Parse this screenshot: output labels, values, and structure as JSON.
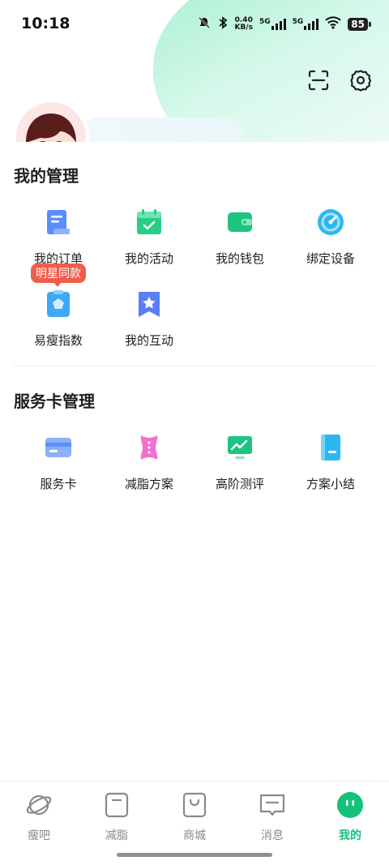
{
  "status_bar": {
    "time": "10:18",
    "net_speed_value": "0.40",
    "net_speed_unit": "KB/s",
    "signal1_label": "5G",
    "signal2_label": "5G",
    "battery": "85"
  },
  "colors": {
    "accent": "#12C27A",
    "badge": "#F25C4A"
  },
  "header": {
    "scan_icon": "scan-icon",
    "settings_icon": "gear-icon"
  },
  "management": {
    "title": "我的管理",
    "items": [
      {
        "label": "我的订单",
        "icon": "order-icon"
      },
      {
        "label": "我的活动",
        "icon": "calendar-check-icon"
      },
      {
        "label": "我的钱包",
        "icon": "wallet-icon"
      },
      {
        "label": "绑定设备",
        "icon": "device-bind-icon"
      },
      {
        "label": "易瘦指数",
        "icon": "clipboard-pentagon-icon",
        "badge": "明星同款"
      },
      {
        "label": "我的互动",
        "icon": "star-bookmark-icon"
      }
    ]
  },
  "service_cards": {
    "title": "服务卡管理",
    "items": [
      {
        "label": "服务卡",
        "icon": "card-icon"
      },
      {
        "label": "减脂方案",
        "icon": "corset-icon"
      },
      {
        "label": "高阶测评",
        "icon": "chart-monitor-icon"
      },
      {
        "label": "方案小结",
        "icon": "notebook-icon"
      }
    ]
  },
  "tabbar": {
    "tabs": [
      {
        "label": "瘦吧",
        "icon": "planet-icon",
        "active": false
      },
      {
        "label": "减脂",
        "icon": "square-icon",
        "active": false
      },
      {
        "label": "商城",
        "icon": "bag-icon",
        "active": false
      },
      {
        "label": "消息",
        "icon": "message-icon",
        "active": false
      },
      {
        "label": "我的",
        "icon": "face-icon",
        "active": true
      }
    ]
  }
}
